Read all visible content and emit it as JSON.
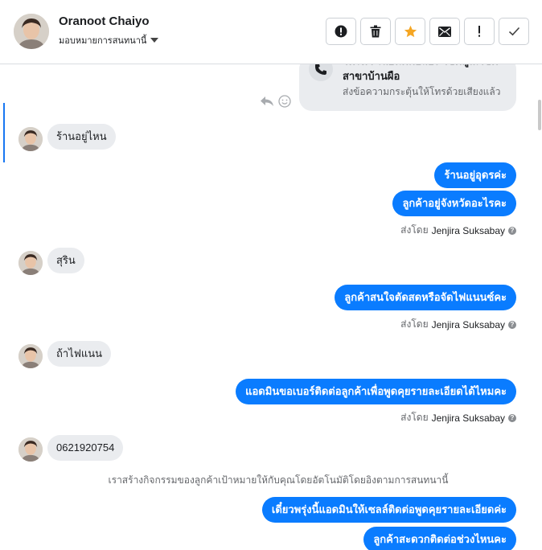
{
  "header": {
    "contact_name": "Oranoot Chaiyo",
    "assign_label": "มอบหมายการสนทนานี้"
  },
  "toolbar": {
    "buttons": [
      "alert-circle-icon",
      "trash-icon",
      "star-icon",
      "mail-icon",
      "exclamation-icon",
      "check-icon"
    ],
    "star_color": "#f5a623"
  },
  "thread": {
    "call_card": {
      "title": "โทรหา รถยนต์มือสอง โชคคูณโชค สาขาบ้านผือ",
      "subtitle": "ส่งข้อความกระตุ้นให้โทรด้วยเสียงแล้ว"
    },
    "incoming": [
      {
        "text": "ร้านอยู่ไหน"
      },
      {
        "text": "สุริน"
      },
      {
        "text": "ถ้าไฟแนน"
      },
      {
        "text": "0621920754"
      }
    ],
    "outgoing": [
      {
        "text": "ร้านอยู่อุดรค่ะ"
      },
      {
        "text": "ลูกค้าอยู่จังหวัดอะไรคะ"
      },
      {
        "text": "ลูกค้าสนใจตัดสดหรือจัดไฟแนนซ์คะ"
      },
      {
        "text": "แอดมินขอเบอร์ติดต่อลูกค้าเพื่อพูดคุยรายละเอียดได้ไหมคะ"
      },
      {
        "text": "เดี๋ยวพรุ่งนี้แอดมินให้เซลล์ติดต่อพูดคุยรายละเอียดค่ะ"
      },
      {
        "text": "ลูกค้าสะดวกติดต่อช่วงไหนคะ"
      }
    ],
    "sent_by": {
      "prefix": "ส่งโดย",
      "agent": "Jenjira Suksabay"
    },
    "auto_note": "เราสร้างกิจกรรมของลูกค้าเป้าหมายให้กับคุณโดยอัตโนมัติโดยอิงตามการสนทนานี้",
    "accent_color": "#0a7cff"
  }
}
